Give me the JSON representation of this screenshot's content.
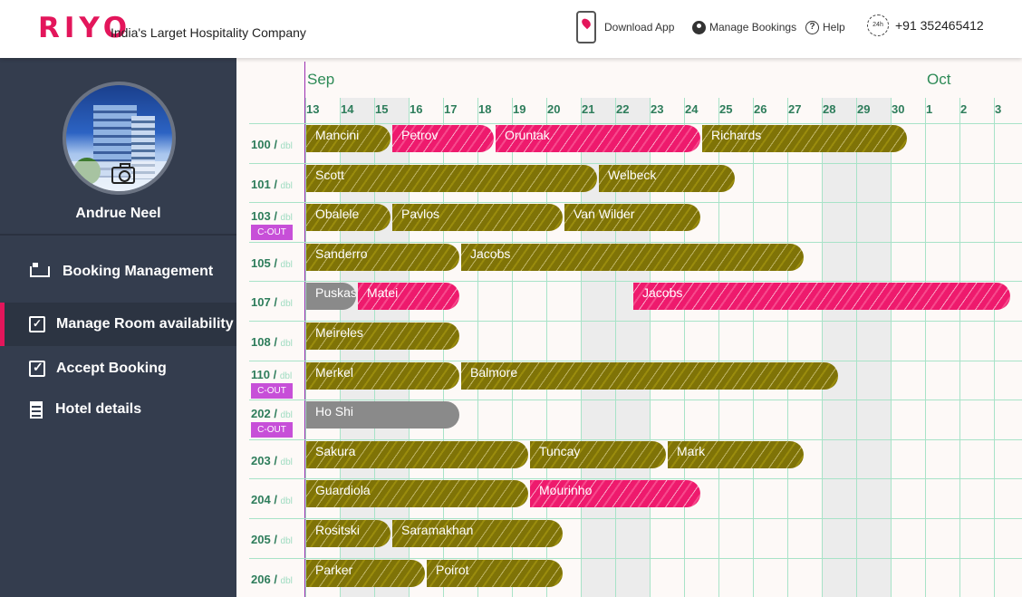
{
  "header": {
    "logo": "RIYO",
    "tagline": "India's Larget Hospitality Company",
    "download_app": "Download App",
    "manage_bookings": "Manage Bookings",
    "help": "Help",
    "clock_label": "24h",
    "phone": "+91 352465412"
  },
  "sidebar": {
    "user_name": "Andrue Neel",
    "items": [
      {
        "label": "Booking Management",
        "icon": "bed-icon"
      },
      {
        "label": "Manage Room availability",
        "icon": "calendar-check-icon",
        "active": true
      },
      {
        "label": "Accept Booking",
        "icon": "checkbox-icon"
      },
      {
        "label": "Hotel details",
        "icon": "building-icon"
      }
    ]
  },
  "calendar": {
    "months": [
      {
        "label": "Sep"
      },
      {
        "label": "Oct"
      }
    ],
    "days": [
      "13",
      "14",
      "15",
      "16",
      "17",
      "18",
      "19",
      "20",
      "21",
      "22",
      "23",
      "24",
      "25",
      "26",
      "27",
      "28",
      "29",
      "30",
      "1",
      "2",
      "3"
    ],
    "rooms": [
      {
        "number": "100",
        "type": "dbl",
        "cout": "",
        "bookings": [
          {
            "guest": "Mancini",
            "start": 0,
            "span": 2.5,
            "color": "olive"
          },
          {
            "guest": "Petrov",
            "start": 2.5,
            "span": 3,
            "color": "pink"
          },
          {
            "guest": "Oruntak",
            "start": 5.5,
            "span": 6,
            "color": "pink"
          },
          {
            "guest": "Richards",
            "start": 11.5,
            "span": 6,
            "color": "olive"
          }
        ]
      },
      {
        "number": "101",
        "type": "dbl",
        "cout": "",
        "bookings": [
          {
            "guest": "Scott",
            "start": 0,
            "span": 8.5,
            "color": "olive"
          },
          {
            "guest": "Welbeck",
            "start": 8.5,
            "span": 4,
            "color": "olive"
          }
        ]
      },
      {
        "number": "103",
        "type": "dbl",
        "cout": "C-OUT",
        "bookings": [
          {
            "guest": "Obalele",
            "start": 0,
            "span": 2.5,
            "color": "olive"
          },
          {
            "guest": "Pavlos",
            "start": 2.5,
            "span": 5,
            "color": "olive"
          },
          {
            "guest": "Van Wilder",
            "start": 7.5,
            "span": 4,
            "color": "olive"
          }
        ]
      },
      {
        "number": "105",
        "type": "dbl",
        "cout": "",
        "bookings": [
          {
            "guest": "Sanderro",
            "start": 0,
            "span": 4.5,
            "color": "olive"
          },
          {
            "guest": "Jacobs",
            "start": 4.5,
            "span": 10,
            "color": "olive"
          }
        ]
      },
      {
        "number": "107",
        "type": "dbl",
        "cout": "",
        "bookings": [
          {
            "guest": "Puskas",
            "start": 0,
            "span": 1.5,
            "color": "grey"
          },
          {
            "guest": "Matei",
            "start": 1.5,
            "span": 3,
            "color": "pink"
          },
          {
            "guest": "Jacobs",
            "start": 9.5,
            "span": 11,
            "color": "pink"
          }
        ]
      },
      {
        "number": "108",
        "type": "dbl",
        "cout": "",
        "bookings": [
          {
            "guest": "Meireles",
            "start": 0,
            "span": 4.5,
            "color": "olive"
          }
        ]
      },
      {
        "number": "110",
        "type": "dbl",
        "cout": "C-OUT",
        "bookings": [
          {
            "guest": "Merkel",
            "start": 0,
            "span": 4.5,
            "color": "olive"
          },
          {
            "guest": "Balmore",
            "start": 4.5,
            "span": 11,
            "color": "olive"
          }
        ]
      },
      {
        "number": "202",
        "type": "dbl",
        "cout": "C-OUT",
        "bookings": [
          {
            "guest": "Ho Shi",
            "start": 0,
            "span": 4.5,
            "color": "grey"
          }
        ]
      },
      {
        "number": "203",
        "type": "dbl",
        "cout": "",
        "bookings": [
          {
            "guest": "Sakura",
            "start": 0,
            "span": 6.5,
            "color": "olive"
          },
          {
            "guest": "Tuncay",
            "start": 6.5,
            "span": 4,
            "color": "olive"
          },
          {
            "guest": "Mark",
            "start": 10.5,
            "span": 4,
            "color": "olive"
          }
        ]
      },
      {
        "number": "204",
        "type": "dbl",
        "cout": "",
        "bookings": [
          {
            "guest": "Guardiola",
            "start": 0,
            "span": 6.5,
            "color": "olive"
          },
          {
            "guest": "Mourinho",
            "start": 6.5,
            "span": 5,
            "color": "pink"
          }
        ]
      },
      {
        "number": "205",
        "type": "dbl",
        "cout": "",
        "bookings": [
          {
            "guest": "Rositski",
            "start": 0,
            "span": 2.5,
            "color": "olive"
          },
          {
            "guest": "Saramakhan",
            "start": 2.5,
            "span": 5,
            "color": "olive"
          }
        ]
      },
      {
        "number": "206",
        "type": "dbl",
        "cout": "",
        "bookings": [
          {
            "guest": "Parker",
            "start": 0,
            "span": 3.5,
            "color": "olive"
          },
          {
            "guest": "Poirot",
            "start": 3.5,
            "span": 4,
            "color": "olive"
          }
        ]
      }
    ]
  }
}
